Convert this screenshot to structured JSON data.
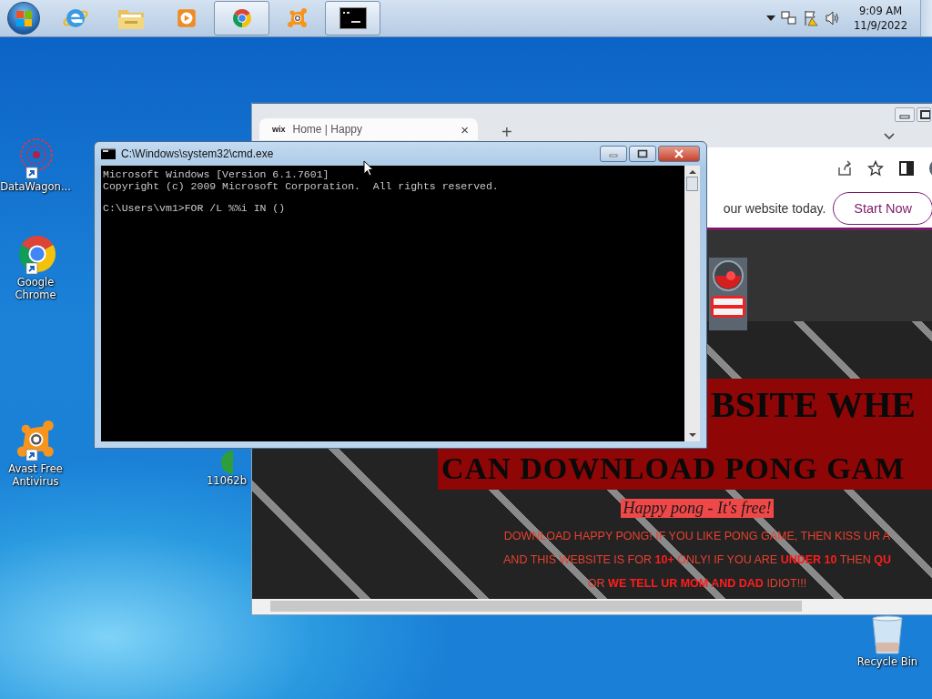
{
  "taskbar": {
    "apps": [
      {
        "kind": "ie",
        "active": false
      },
      {
        "kind": "explorer",
        "active": false
      },
      {
        "kind": "media",
        "active": false
      },
      {
        "kind": "chrome",
        "active": true
      },
      {
        "kind": "avast",
        "active": false
      },
      {
        "kind": "cmd",
        "active": true
      }
    ],
    "clock": {
      "time": "9:09 AM",
      "date": "11/9/2022"
    }
  },
  "desktop_icons": [
    {
      "kind": "datawagon",
      "label": "DataWagon..."
    },
    {
      "kind": "chrome",
      "label": "Google Chrome"
    },
    {
      "kind": "avast",
      "label": "Avast Free Antivirus"
    },
    {
      "kind": "file",
      "label": "11062b"
    },
    {
      "kind": "recycle",
      "label": "Recycle Bin"
    }
  ],
  "browser": {
    "tabs": [
      {
        "favicon": "wix",
        "title": "Home | Happy",
        "close": "×",
        "selected": true
      }
    ],
    "new_tab": "+",
    "promo": {
      "text": "our website today.",
      "button": "Start Now"
    },
    "page": {
      "heading_lines": [
        "BSITE WHE",
        "CAN DOWNLOAD PONG GAM"
      ],
      "tagline": "Happy pong - It's free!",
      "paragraph_lines": [
        "DOWNLOAD HAPPY PONG! IF YOU LIKE PONG GAME, THEN KISS UR A",
        "AND THIS WEBSITE IS FOR **10+** ONLY! IF YOU ARE **UNDER 10** THEN **QU**",
        "OR **WE TELL UR MOM AND DAD** IDIOT!!!"
      ]
    }
  },
  "cmd": {
    "title": "C:\\Windows\\system32\\cmd.exe",
    "output": [
      "Microsoft Windows [Version 6.1.7601]",
      "Copyright (c) 2009 Microsoft Corporation.  All rights reserved."
    ],
    "prompt": "C:\\Users\\vm1>FOR /L %%i IN ()"
  }
}
